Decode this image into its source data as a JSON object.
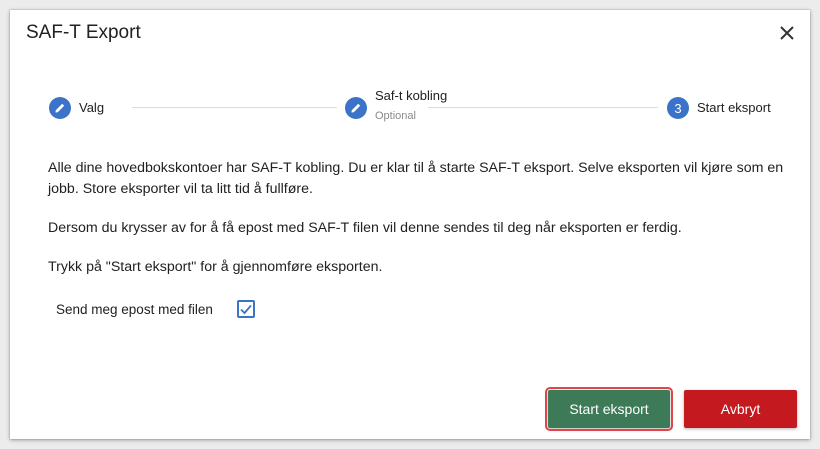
{
  "dialog": {
    "title": "SAF-T Export",
    "close_icon": "close-icon"
  },
  "stepper": {
    "steps": [
      {
        "label": "Valg",
        "icon": "pencil-icon",
        "state": "completed"
      },
      {
        "label": "Saf-t kobling",
        "sublabel": "Optional",
        "icon": "pencil-icon",
        "state": "completed"
      },
      {
        "label": "Start eksport",
        "number": "3",
        "state": "active"
      }
    ]
  },
  "body": {
    "p1": "Alle dine hovedbokskontoer har SAF-T kobling. Du er klar til å starte SAF-T eksport. Selve eksporten vil kjøre som en jobb. Store eksporter vil ta litt tid å fullføre.",
    "p2": "Dersom du krysser av for å få epost med SAF-T filen vil denne sendes til deg når eksporten er ferdig.",
    "p3": "Trykk på \"Start eksport\" for å gjennomføre eksporten."
  },
  "email_option": {
    "label": "Send meg epost med filen",
    "checked": true
  },
  "actions": {
    "start_label": "Start eksport",
    "cancel_label": "Avbryt"
  },
  "colors": {
    "accent": "#3a73c8",
    "start_button": "#3d7a58",
    "cancel_button": "#c41a1f",
    "focus_outline": "#e0454a"
  }
}
